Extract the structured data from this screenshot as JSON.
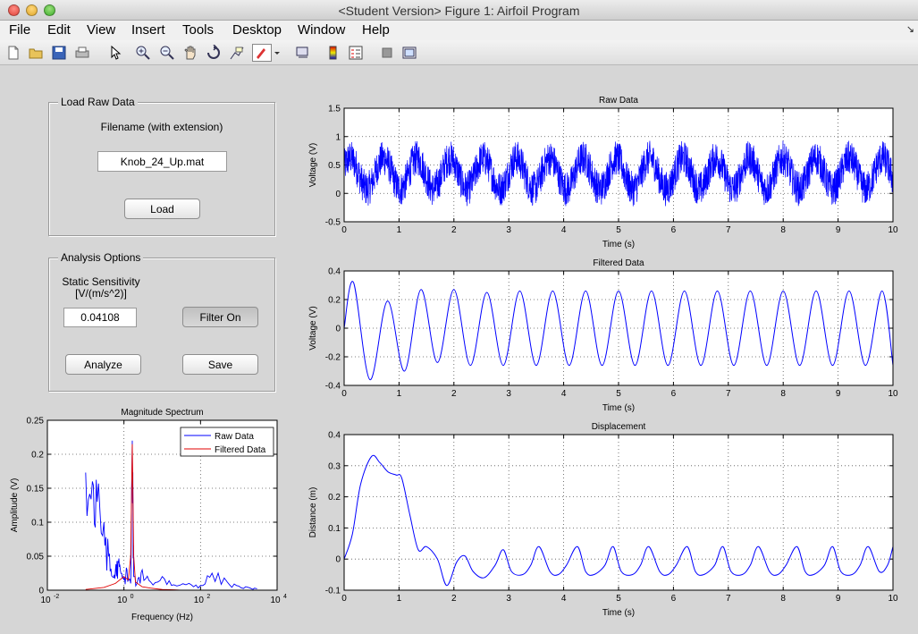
{
  "window": {
    "title": "<Student Version> Figure 1: Airfoil Program"
  },
  "menu": [
    "File",
    "Edit",
    "View",
    "Insert",
    "Tools",
    "Desktop",
    "Window",
    "Help"
  ],
  "toolbar": [
    "new-figure-icon",
    "open-file-icon",
    "save-icon",
    "print-icon",
    "pointer-icon",
    "zoom-in-icon",
    "zoom-out-icon",
    "pan-icon",
    "rotate-icon",
    "data-cursor-icon",
    "brush-icon",
    "dropdown-icon",
    "link-icon",
    "colorbar-icon",
    "legend-icon",
    "hide-tools-icon",
    "show-tools-icon"
  ],
  "load_panel": {
    "title": "Load Raw Data",
    "filename_label": "Filename (with extension)",
    "filename_value": "Knob_24_Up.mat",
    "load_button": "Load"
  },
  "analysis_panel": {
    "title": "Analysis Options",
    "sensitivity_label_line1": "Static Sensitivity",
    "sensitivity_label_line2": "[V/(m/s^2)]",
    "sensitivity_value": "0.04108",
    "filter_button": "Filter On",
    "analyze_button": "Analyze",
    "save_button": "Save"
  },
  "colors": {
    "raw": "#0000ff",
    "filtered": "#e00000"
  },
  "chart_data": [
    {
      "id": "raw",
      "type": "line",
      "title": "Raw Data",
      "xlabel": "Time (s)",
      "ylabel": "Voltage (V)",
      "xlim": [
        0,
        10
      ],
      "ylim": [
        -0.5,
        1.5
      ],
      "xticks": [
        0,
        1,
        2,
        3,
        4,
        5,
        6,
        7,
        8,
        9,
        10
      ],
      "yticks": [
        -0.5,
        0,
        0.5,
        1,
        1.5
      ],
      "grid": true,
      "series": [
        {
          "signal": "noisy-sinusoid",
          "frequency_hz": 1.65,
          "offset": 0.35,
          "amplitude": 0.27,
          "noise": 0.14,
          "color": "#0000ff"
        }
      ]
    },
    {
      "id": "filtered",
      "type": "line",
      "title": "Filtered Data",
      "xlabel": "Time (s)",
      "ylabel": "Voltage (V)",
      "xlim": [
        0,
        10
      ],
      "ylim": [
        -0.4,
        0.4
      ],
      "xticks": [
        0,
        1,
        2,
        3,
        4,
        5,
        6,
        7,
        8,
        9,
        10
      ],
      "yticks": [
        -0.4,
        -0.2,
        0,
        0.2,
        0.4
      ],
      "grid": true,
      "x": [
        0,
        0.17,
        0.47,
        0.79,
        1.1,
        1.4,
        1.7,
        2.0,
        2.3,
        2.6,
        2.9,
        3.2,
        3.5,
        3.8,
        4.1,
        4.4,
        4.7,
        5.0,
        5.3,
        5.6,
        5.9,
        6.2,
        6.5,
        6.8,
        7.1,
        7.4,
        7.7,
        8.0,
        8.3,
        8.6,
        8.9,
        9.2,
        9.5,
        9.8,
        10
      ],
      "series": [
        {
          "values": [
            0,
            0.32,
            -0.36,
            0.19,
            -0.3,
            0.27,
            -0.24,
            0.27,
            -0.26,
            0.25,
            -0.26,
            0.26,
            -0.26,
            0.26,
            -0.26,
            0.26,
            -0.26,
            0.26,
            -0.26,
            0.26,
            -0.26,
            0.26,
            -0.26,
            0.26,
            -0.26,
            0.26,
            -0.26,
            0.26,
            -0.26,
            0.26,
            -0.26,
            0.26,
            -0.26,
            0.26,
            -0.26
          ],
          "color": "#0000ff"
        }
      ]
    },
    {
      "id": "displacement",
      "type": "line",
      "title": "Displacement",
      "xlabel": "Time (s)",
      "ylabel": "Distance (m)",
      "xlim": [
        0,
        10
      ],
      "ylim": [
        -0.1,
        0.4
      ],
      "xticks": [
        0,
        1,
        2,
        3,
        4,
        5,
        6,
        7,
        8,
        9,
        10
      ],
      "yticks": [
        -0.1,
        0,
        0.1,
        0.2,
        0.3,
        0.4
      ],
      "grid": true,
      "x": [
        0,
        0.15,
        0.3,
        0.5,
        0.65,
        0.8,
        0.95,
        1.05,
        1.2,
        1.35,
        1.5,
        1.7,
        1.87,
        2.05,
        2.2,
        2.35,
        2.55,
        2.75,
        2.9,
        3.05,
        3.25,
        3.4,
        3.55,
        3.75,
        3.9,
        4.05,
        4.25,
        4.4,
        4.55,
        4.75,
        4.9,
        5.05,
        5.25,
        5.4,
        5.55,
        5.75,
        5.9,
        6.05,
        6.25,
        6.4,
        6.55,
        6.75,
        6.9,
        7.05,
        7.25,
        7.4,
        7.55,
        7.75,
        7.9,
        8.05,
        8.25,
        8.4,
        8.55,
        8.75,
        8.9,
        9.05,
        9.25,
        9.4,
        9.55,
        9.75,
        9.9,
        10
      ],
      "series": [
        {
          "values": [
            0,
            0.08,
            0.24,
            0.33,
            0.31,
            0.28,
            0.27,
            0.26,
            0.14,
            0.03,
            0.04,
            0.0,
            -0.085,
            -0.01,
            0.01,
            -0.04,
            -0.06,
            -0.02,
            0.03,
            -0.04,
            -0.05,
            -0.02,
            0.04,
            -0.04,
            -0.05,
            -0.02,
            0.04,
            -0.04,
            -0.05,
            -0.02,
            0.04,
            -0.04,
            -0.05,
            -0.02,
            0.04,
            -0.04,
            -0.05,
            -0.02,
            0.04,
            -0.04,
            -0.05,
            -0.02,
            0.04,
            -0.04,
            -0.05,
            -0.02,
            0.04,
            -0.04,
            -0.05,
            -0.02,
            0.04,
            -0.04,
            -0.05,
            -0.02,
            0.04,
            -0.04,
            -0.05,
            -0.02,
            0.04,
            -0.04,
            -0.02,
            0.04
          ],
          "color": "#0000ff"
        }
      ]
    },
    {
      "id": "spectrum",
      "type": "line",
      "title": "Magnitude Spectrum",
      "xlabel": "Frequency (Hz)",
      "ylabel": "Amplitude (V)",
      "xscale": "log",
      "xlim": [
        0.01,
        10000
      ],
      "ylim": [
        0,
        0.25
      ],
      "xtick_exponents": [
        "-2",
        "0",
        "2",
        "4"
      ],
      "yticks": [
        0,
        0.05,
        0.1,
        0.15,
        0.2,
        0.25
      ],
      "grid": true,
      "legend": {
        "placement": "top-right",
        "entries": [
          "Raw Data",
          "Filtered Data"
        ]
      },
      "series": [
        {
          "name": "Raw Data",
          "color": "#0000ff",
          "x": [
            0.1,
            0.15,
            0.2,
            0.3,
            0.4,
            0.5,
            0.6,
            0.7,
            0.8,
            1.0,
            1.2,
            1.5,
            1.65,
            1.8,
            2.2,
            3,
            5,
            10,
            20,
            50,
            100,
            200,
            500,
            1000,
            2000,
            3000
          ],
          "values": [
            0.173,
            0.16,
            0.13,
            0.1,
            0.05,
            0.02,
            0.03,
            0.042,
            0.03,
            0.015,
            0.03,
            0.01,
            0.22,
            0.02,
            0.01,
            0.03,
            0.012,
            0.02,
            0.008,
            0.01,
            0.007,
            0.025,
            0.012,
            0.006,
            0.003,
            0.002
          ]
        },
        {
          "name": "Filtered Data",
          "color": "#e00000",
          "x": [
            0.1,
            0.3,
            0.6,
            1.0,
            1.3,
            1.5,
            1.65,
            1.8,
            2.0,
            3,
            5,
            10,
            20,
            30
          ],
          "values": [
            0.001,
            0.004,
            0.01,
            0.02,
            0.015,
            0.05,
            0.215,
            0.05,
            0.012,
            0.005,
            0.003,
            0.001,
            0.0005,
            0
          ]
        }
      ]
    }
  ]
}
